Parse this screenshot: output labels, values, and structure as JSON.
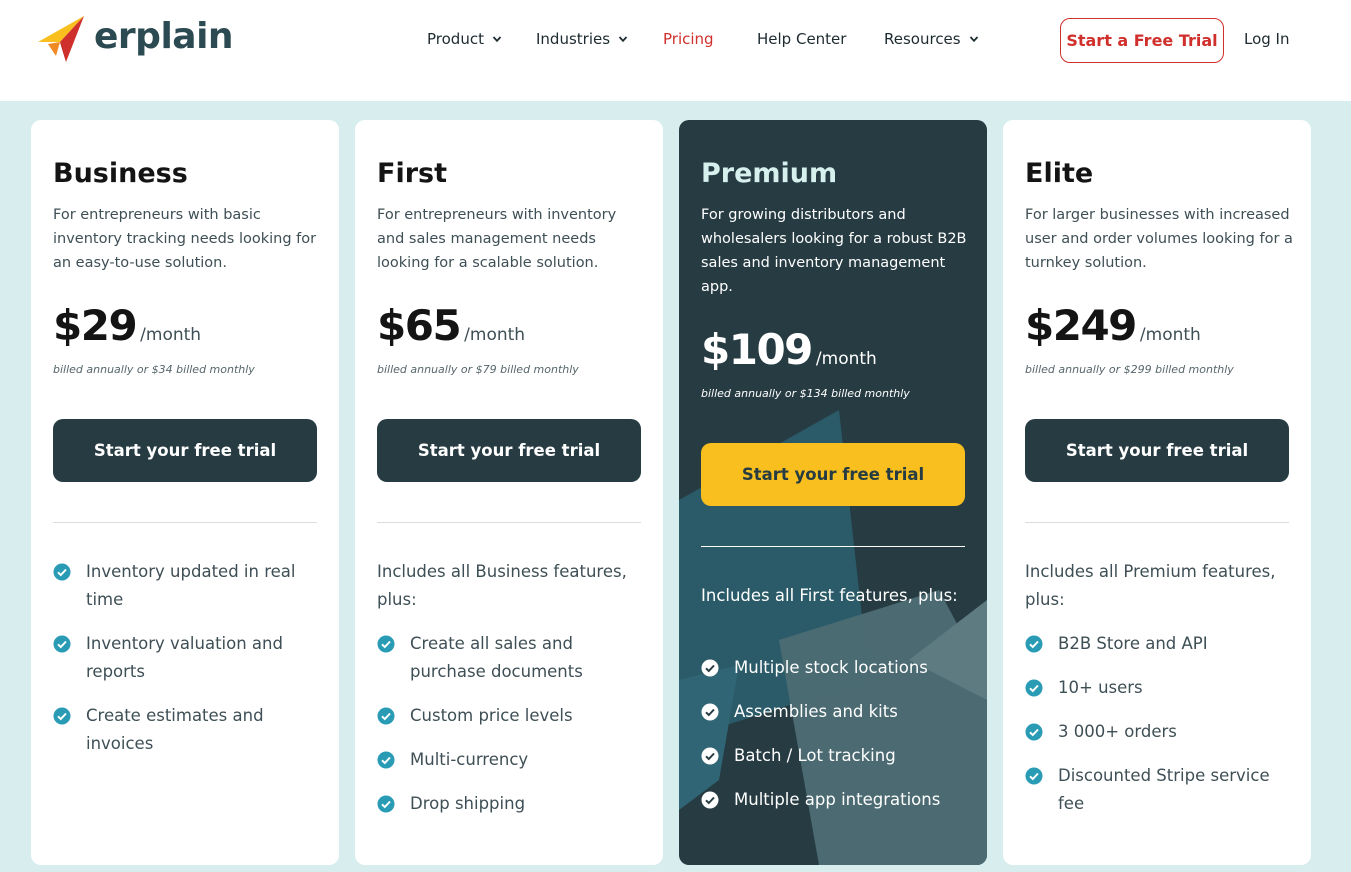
{
  "brand": {
    "name": "erplain",
    "colors": {
      "accent_red": "#d0302c",
      "dark_teal": "#263b42",
      "yellow": "#f8bf1f",
      "check_teal": "#2a9bb4",
      "bg_mint": "#d8eeee"
    }
  },
  "nav": {
    "items": [
      {
        "label": "Product",
        "has_dropdown": true
      },
      {
        "label": "Industries",
        "has_dropdown": true
      },
      {
        "label": "Pricing",
        "has_dropdown": false,
        "active": true
      },
      {
        "label": "Help Center",
        "has_dropdown": false
      },
      {
        "label": "Resources",
        "has_dropdown": true
      }
    ],
    "trial_button": "Start a Free Trial",
    "login": "Log In"
  },
  "plans": [
    {
      "name": "Business",
      "description": "For entrepreneurs with basic inventory tracking needs looking for an easy-to-use solution.",
      "price": "$29",
      "period": "/month",
      "billed": "billed annually or $34 billed monthly",
      "cta": "Start your free trial",
      "includes": "",
      "features": [
        "Inventory updated in real time",
        "Inventory valuation and reports",
        "Create estimates and invoices"
      ]
    },
    {
      "name": "First",
      "description": "For entrepreneurs with inventory and sales management needs looking for a scalable solution.",
      "price": "$65",
      "period": "/month",
      "billed": "billed annually or $79 billed monthly",
      "cta": "Start your free trial",
      "includes": "Includes all Business features, plus:",
      "features": [
        "Create all sales and purchase documents",
        "Custom price levels",
        "Multi-currency",
        "Drop shipping"
      ]
    },
    {
      "name": "Premium",
      "description": "For growing distributors and wholesalers looking for a robust B2B sales and inventory management app.",
      "price": "$109",
      "period": "/month",
      "billed": "billed annually or $134 billed monthly",
      "cta": "Start your free trial",
      "includes": "Includes all First features, plus:",
      "features": [
        "Multiple stock locations",
        "Assemblies and kits",
        "Batch / Lot tracking",
        "Multiple app integrations"
      ]
    },
    {
      "name": "Elite",
      "description": "For larger businesses with increased user and order volumes looking for a turnkey solution.",
      "price": "$249",
      "period": "/month",
      "billed": "billed annually or $299 billed monthly",
      "cta": "Start your free trial",
      "includes": "Includes all Premium features, plus:",
      "features": [
        "B2B Store and API",
        "10+ users",
        "3 000+ orders",
        "Discounted Stripe service fee"
      ]
    }
  ]
}
